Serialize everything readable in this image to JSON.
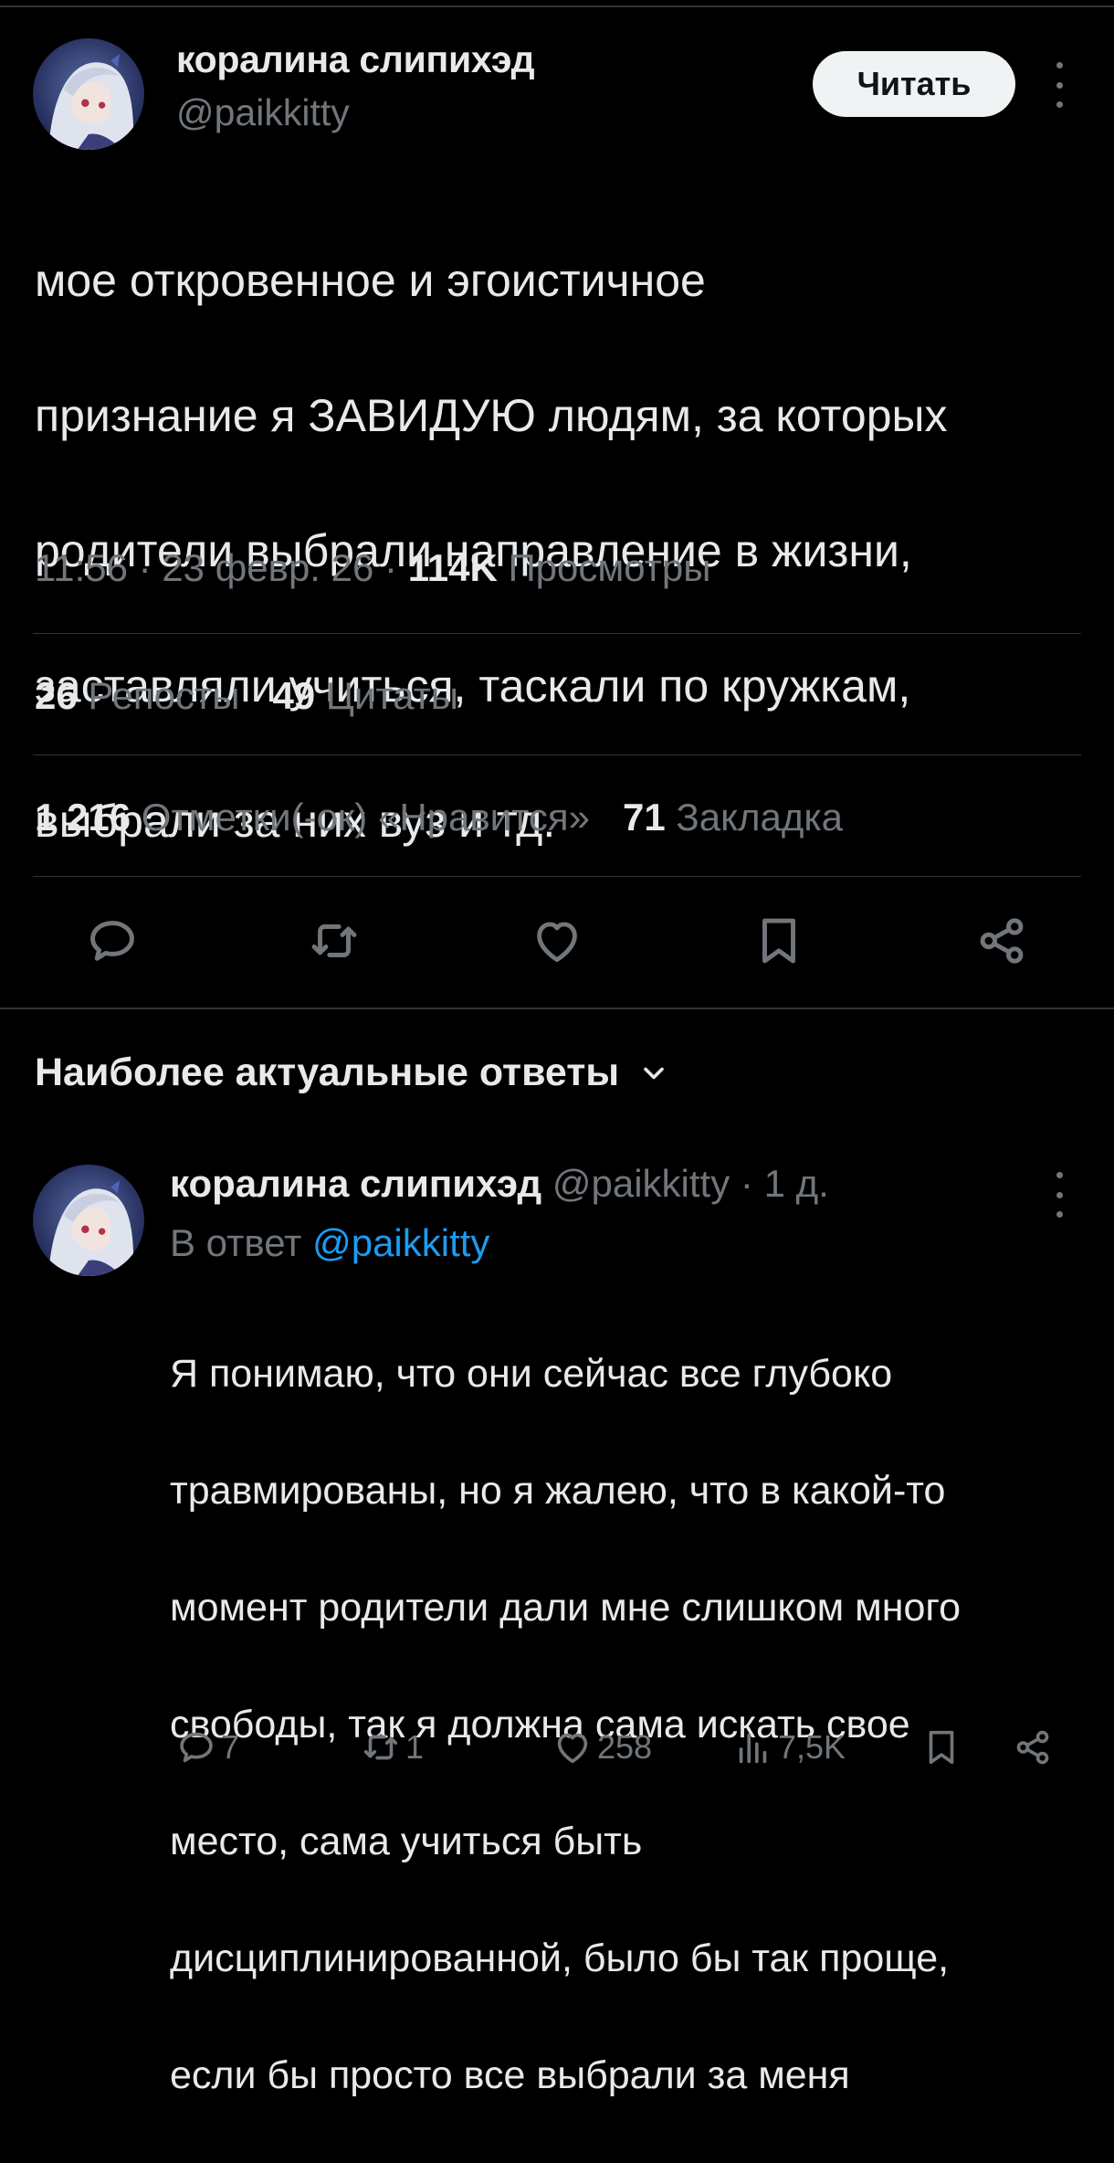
{
  "tweet": {
    "author": {
      "name": "коралина слипихэд",
      "handle": "@paikkitty"
    },
    "follow_label": "Читать",
    "more_icon": "more-vertical-icon",
    "lines": [
      "мое откровенное и эгоистичное",
      "признание я ЗАВИДУЮ людям, за которых",
      "родители выбрали направление в жизни,",
      "заставляли учиться, таскали по кружкам,",
      "выбрали за них вуз и тд."
    ],
    "time": "11:56",
    "date": "23 февр. 26",
    "views_count": "114K",
    "views_label": "Просмотры",
    "reposts_count": "26",
    "reposts_label": "Репосты",
    "quotes_count": "49",
    "quotes_label": "Цитаты",
    "likes_count": "1 216",
    "likes_label": "Отметки(-ок) «Нравится»",
    "bookmarks_count": "71",
    "bookmarks_label": "Закладка",
    "actions": [
      "reply-icon",
      "retweet-icon",
      "like-icon",
      "bookmark-icon",
      "share-icon"
    ]
  },
  "replies_section": {
    "heading": "Наиболее актуальные ответы"
  },
  "reply": {
    "author_name": "коралина слипихэд",
    "handle": "@paikkitty",
    "separator": "·",
    "time_ago": "1 д.",
    "reply_to_prefix": "В ответ",
    "reply_to_handle": "@paikkitty",
    "lines": [
      "Я понимаю, что они сейчас все глубоко",
      "травмированы, но я жалею, что в какой-то",
      "момент родители дали мне слишком много",
      "свободы, так я должна сама искать свое",
      "место, сама учиться быть",
      "дисциплинированной, было бы так проще,",
      "если бы просто все выбрали за меня"
    ],
    "replies_count": "7",
    "reposts_count": "1",
    "likes_count": "258",
    "views_count": "7,5K"
  },
  "colors": {
    "background": "#000000",
    "text_primary": "#e7e9ea",
    "text_secondary": "#71767b",
    "divider": "#2f3336",
    "link": "#1d9bf0",
    "button_bg": "#eff3f4"
  }
}
